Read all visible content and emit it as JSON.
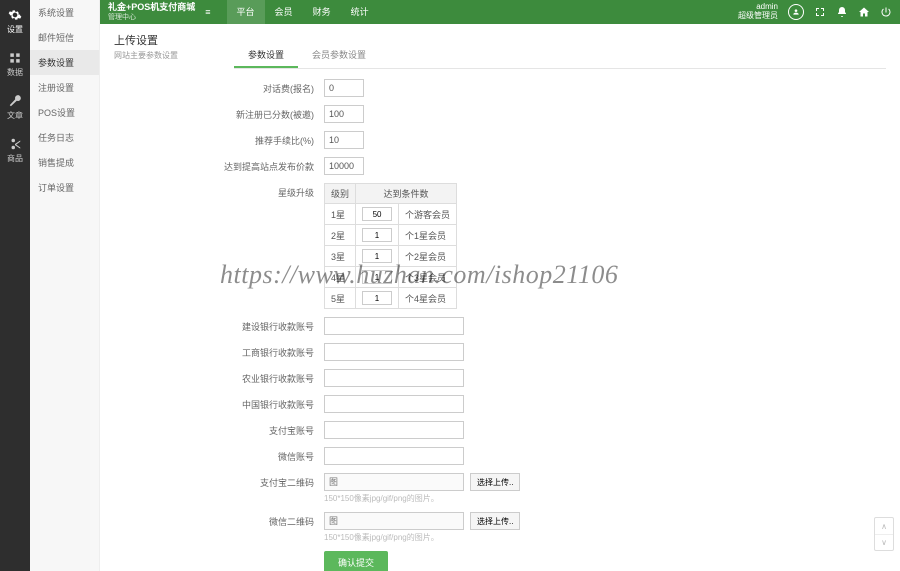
{
  "brand": {
    "title": "礼金+POS机支付商城",
    "sub": "管理中心"
  },
  "topnav": [
    "平台",
    "会员",
    "财务",
    "统计"
  ],
  "topright": {
    "user": "admin",
    "role": "超级管理员"
  },
  "leftbar": [
    {
      "key": "settings",
      "label": "设置"
    },
    {
      "key": "data",
      "label": "数据"
    },
    {
      "key": "article",
      "label": "文章"
    },
    {
      "key": "goods",
      "label": "商品"
    }
  ],
  "sidenav": [
    "系统设置",
    "邮件短信",
    "参数设置",
    "注册设置",
    "POS设置",
    "任务日志",
    "销售提成",
    "订单设置"
  ],
  "page": {
    "title": "上传设置",
    "sub": "网站主要参数设置"
  },
  "tabs": [
    "参数设置",
    "会员参数设置"
  ],
  "fields": {
    "f1_label": "对话费(报名)",
    "f1": "0",
    "f2_label": "新注册已分数(被邀)",
    "f2": "100",
    "f3_label": "推荐手续比(%)",
    "f3": "10",
    "f4_label": "达到提高站点发布价款",
    "f4": "10000",
    "tlabel": "星级升级",
    "th1": "级别",
    "th2": "达到条件数",
    "r1a": "1星",
    "r1b": "50",
    "r1c": "个游客会员",
    "r2a": "2星",
    "r2b": "1",
    "r2c": "个1星会员",
    "r3a": "3星",
    "r3b": "1",
    "r3c": "个2星会员",
    "r4a": "4星",
    "r4b": "1",
    "r4c": "个3星会员",
    "r5a": "5星",
    "r5b": "1",
    "r5c": "个4星会员",
    "b1": "建设银行收款账号",
    "b2": "工商银行收款账号",
    "b3": "农业银行收款账号",
    "b4": "中国银行收款账号",
    "b5": "支付宝账号",
    "b6": "微信账号",
    "u1_label": "支付宝二维码",
    "u2_label": "微信二维码",
    "upload_placeholder": "图",
    "upload_btn": "选择上传..",
    "hint": "150*150像素jpg/gif/png的图片。",
    "submit": "确认提交"
  },
  "watermark": "https://www.huzhan.com/ishop21106"
}
